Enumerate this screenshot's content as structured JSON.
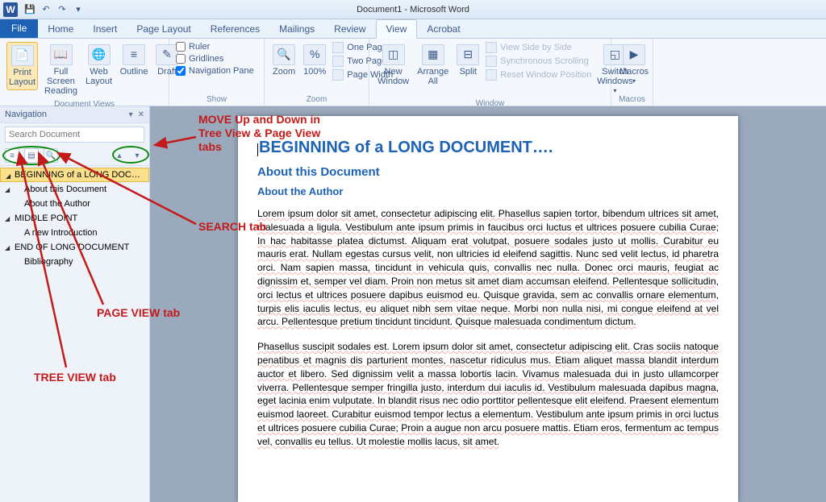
{
  "titlebar": {
    "title": "Document1 - Microsoft Word"
  },
  "tabs": [
    "File",
    "Home",
    "Insert",
    "Page Layout",
    "References",
    "Mailings",
    "Review",
    "View",
    "Acrobat"
  ],
  "active_tab": "View",
  "ribbon": {
    "document_views": {
      "label": "Document Views",
      "buttons": [
        "Print Layout",
        "Full Screen Reading",
        "Web Layout",
        "Outline",
        "Draft"
      ]
    },
    "show": {
      "label": "Show",
      "ruler": "Ruler",
      "gridlines": "Gridlines",
      "navpane": "Navigation Pane"
    },
    "zoom": {
      "label": "Zoom",
      "zoom": "Zoom",
      "hundred": "100%",
      "one_page": "One Page",
      "two_pages": "Two Pages",
      "page_width": "Page Width"
    },
    "window": {
      "label": "Window",
      "new_window": "New Window",
      "arrange_all": "Arrange All",
      "split": "Split",
      "side_by_side": "View Side by Side",
      "sync": "Synchronous Scrolling",
      "reset": "Reset Window Position",
      "switch": "Switch Windows"
    },
    "macros": {
      "label": "Macros",
      "btn": "Macros"
    }
  },
  "navpane": {
    "title": "Navigation",
    "search_placeholder": "Search Document",
    "tree": [
      {
        "label": "BEGINNING of a LONG DOCU…",
        "sel": true,
        "caret": true
      },
      {
        "label": "About this Document",
        "sub": true,
        "caret": true
      },
      {
        "label": "About the Author",
        "sub": true
      },
      {
        "label": "MIDDLE POINT",
        "caret": true
      },
      {
        "label": "A new Introduction",
        "sub": true
      },
      {
        "label": "END OF LONG DOCUMENT",
        "caret": true
      },
      {
        "label": "Bibliography",
        "sub": true
      }
    ]
  },
  "doc": {
    "h1": "BEGINNING of a LONG DOCUMENT….",
    "h2": "About this Document",
    "h3": "About the Author",
    "p1": "Lorem ipsum dolor sit amet, consectetur adipiscing elit. Phasellus sapien tortor, bibendum ultrices sit amet, malesuada a ligula. Vestibulum ante ipsum primis in faucibus orci luctus et ultrices posuere cubilia Curae; In hac habitasse platea dictumst. Aliquam erat volutpat, posuere sodales justo ut mollis. Curabitur eu mauris erat. Nullam egestas cursus velit, non ultricies id eleifend sagittis. Nunc sed velit lectus, id pharetra orci. Nam sapien massa, tincidunt in vehicula quis, convallis nec nulla. Donec orci mauris, feugiat ac dignissim et, semper vel diam. Proin non metus sit amet diam accumsan eleifend. Pellentesque sollicitudin, orci lectus et ultrices posuere dapibus euismod eu. Quisque gravida, sem ac convallis ornare elementum, turpis elis iaculis lectus, eu aliquet nibh sem vitae neque. Morbi non nulla nisi, mi congue eleifend at vel arcu. Pellentesque pretium tincidunt tincidunt. Quisque malesuada condimentum dictum.",
    "p2": "Phasellus suscipit sodales est. Lorem ipsum dolor sit amet, consectetur adipiscing elit. Cras sociis natoque penatibus et magnis dis parturient montes, nascetur ridiculus mus. Etiam aliquet massa blandit interdum auctor et libero. Sed dignissim velit a massa lobortis lacin. Vivamus malesuada dui in justo ullamcorper viverra. Pellentesque semper fringilla justo, interdum dui iaculis id. Vestibulum malesuada dapibus magna, eget lacinia enim vulputate. In blandit risus nec odio porttitor pellentesque elit eleifend. Praesent elementum euismod laoreet. Curabitur euismod tempor lectus a elementum. Vestibulum ante ipsum primis in orci luctus et ultrices posuere cubilia Curae; Proin a augue non arcu posuere mattis. Etiam eros, fermentum ac tempus vel, convallis eu tellus. Ut molestie mollis lacus, sit amet."
  },
  "annotations": {
    "move": "MOVE Up and Down in Tree View & Page View tabs",
    "search": "SEARCH tab",
    "page": "PAGE VIEW tab",
    "tree": "TREE VIEW tab"
  }
}
